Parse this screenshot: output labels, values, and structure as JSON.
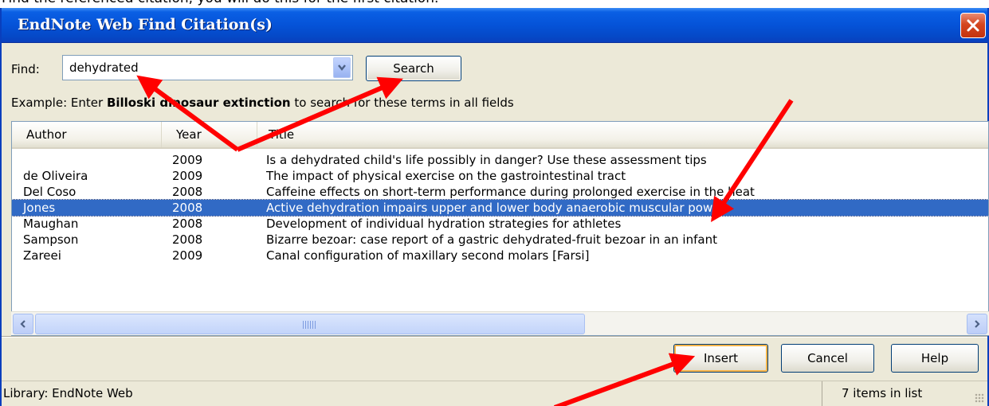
{
  "top_text": "Find the referenced citation, you will do this for the first citation.",
  "window": {
    "title": "EndNote Web Find Citation(s)"
  },
  "find": {
    "label": "Find:",
    "value": "dehydrated",
    "search_label": "Search"
  },
  "example": {
    "prefix": "Example: Enter ",
    "bold": "Billoski dinosaur extinction",
    "suffix": " to search for these terms in all fields"
  },
  "columns": {
    "author": "Author",
    "year": "Year",
    "title": "Title"
  },
  "rows": [
    {
      "author": "",
      "year": "2009",
      "title": "Is a dehydrated child's life possibly in danger? Use these assessment tips"
    },
    {
      "author": "de Oliveira",
      "year": "2009",
      "title": "The impact of physical exercise on the gastrointestinal tract"
    },
    {
      "author": "Del Coso",
      "year": "2008",
      "title": "Caffeine effects on short-term performance during prolonged exercise in the heat"
    },
    {
      "author": "Jones",
      "year": "2008",
      "title": "Active dehydration impairs upper and lower body anaerobic muscular power",
      "selected": true
    },
    {
      "author": "Maughan",
      "year": "2008",
      "title": "Development of individual hydration strategies for athletes"
    },
    {
      "author": "Sampson",
      "year": "2008",
      "title": "Bizarre bezoar: case report of a gastric dehydrated-fruit bezoar in an infant"
    },
    {
      "author": "Zareei",
      "year": "2009",
      "title": "Canal configuration of maxillary second molars [Farsi]"
    }
  ],
  "buttons": {
    "insert": "Insert",
    "cancel": "Cancel",
    "help": "Help"
  },
  "status": {
    "library": "Library: EndNote Web",
    "count": "7 items in list"
  },
  "colors": {
    "titlebar": "#0553d8",
    "selection": "#316ac5",
    "annotation_arrow": "#ff0000",
    "close_button": "#d4461f"
  },
  "icons": {
    "close": "close-icon",
    "combo_arrow": "chevron-down-icon",
    "scroll_left": "chevron-left-icon",
    "scroll_right": "chevron-right-icon"
  }
}
